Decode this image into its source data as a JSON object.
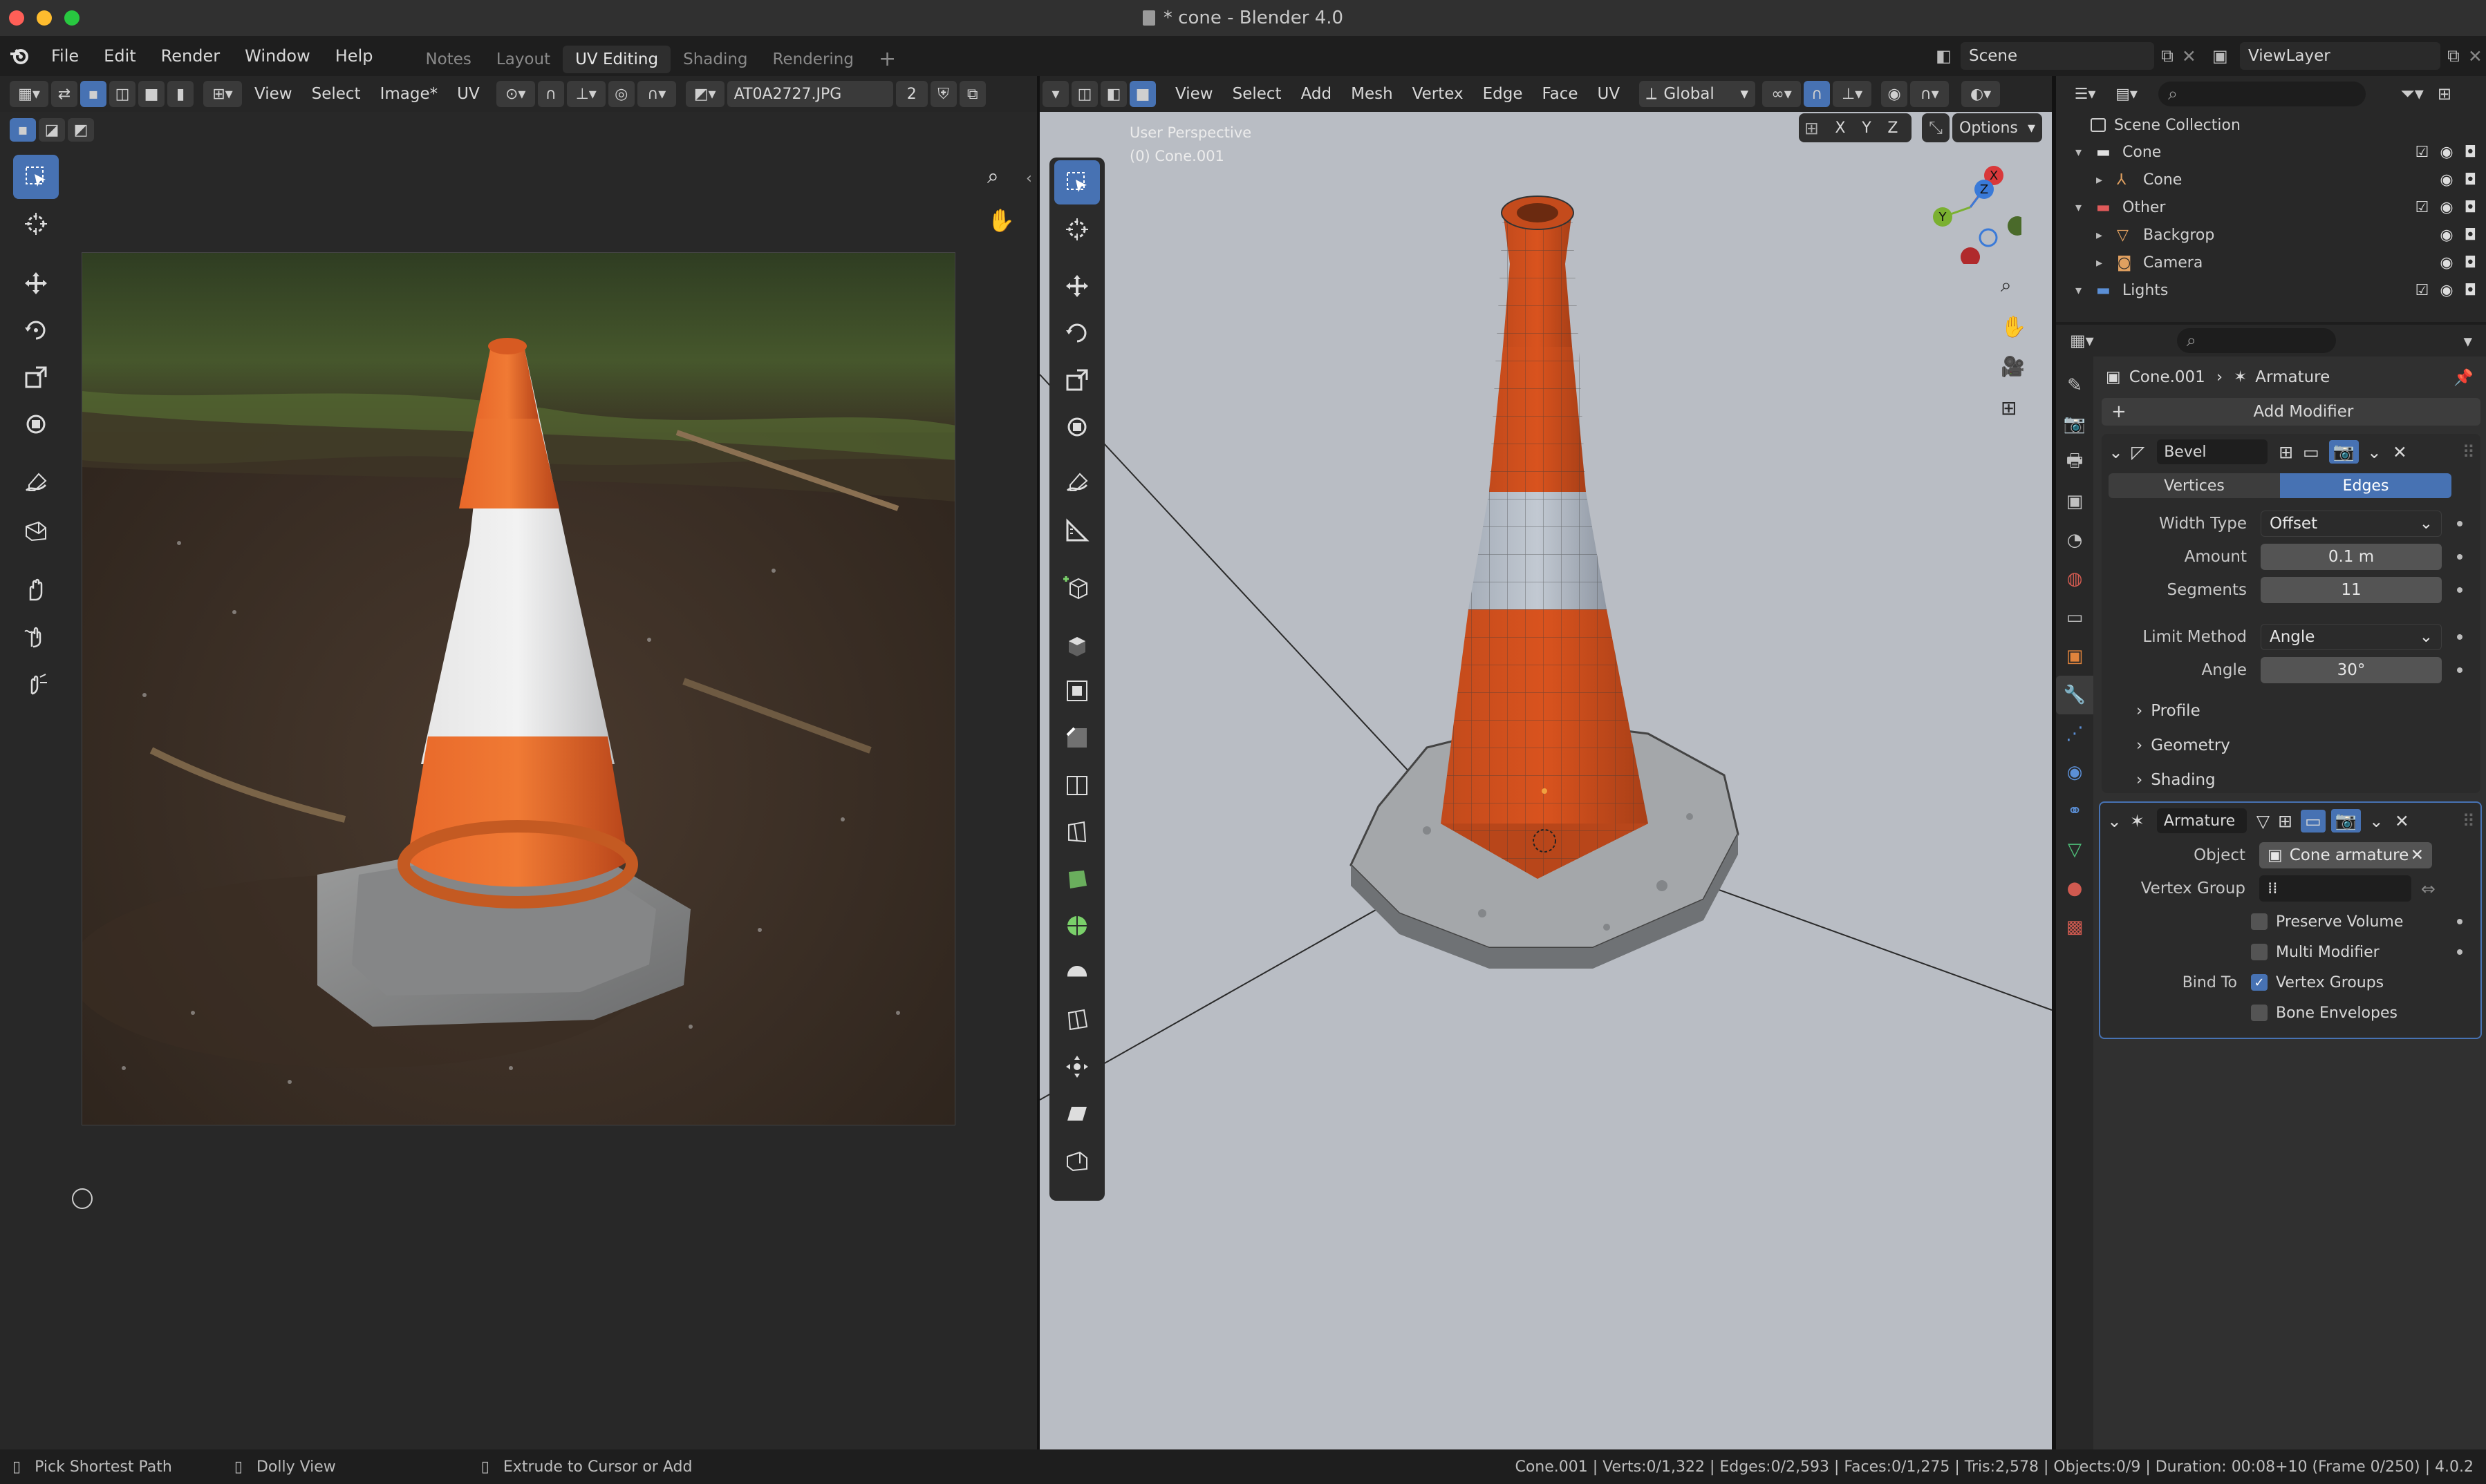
{
  "window": {
    "title": "* cone - Blender 4.0"
  },
  "menu": {
    "items": [
      "File",
      "Edit",
      "Render",
      "Window",
      "Help"
    ]
  },
  "workspaces": {
    "tabs": [
      "Notes",
      "Layout",
      "UV Editing",
      "Shading",
      "Rendering"
    ],
    "add": "+",
    "active": "UV Editing"
  },
  "scene": {
    "label": "Scene",
    "view_layer": "ViewLayer"
  },
  "uv_editor": {
    "menus": [
      "View",
      "Select",
      "Image*",
      "UV"
    ],
    "image_name": "AT0A2727.JPG",
    "user_count": "2"
  },
  "viewport": {
    "menus": [
      "View",
      "Select",
      "Add",
      "Mesh",
      "Vertex",
      "Edge",
      "Face",
      "UV"
    ],
    "orientation": "Global",
    "axes": [
      "X",
      "Y",
      "Z"
    ],
    "options": "Options",
    "overlay_title": "User Perspective",
    "overlay_object": "(0) Cone.001",
    "gizmo_labels": {
      "x": "X",
      "y": "Y",
      "z": "Z"
    }
  },
  "outliner": {
    "root": "Scene Collection",
    "rows": [
      {
        "name": "Cone",
        "indent": 1,
        "type": "collection"
      },
      {
        "name": "Cone",
        "indent": 2,
        "type": "armature"
      },
      {
        "name": "Other",
        "indent": 1,
        "type": "collection-red"
      },
      {
        "name": "Backgrop",
        "indent": 2,
        "type": "mesh"
      },
      {
        "name": "Camera",
        "indent": 2,
        "type": "camera"
      },
      {
        "name": "Lights",
        "indent": 1,
        "type": "collection-blue"
      }
    ]
  },
  "properties": {
    "breadcrumb": {
      "object": "Cone.001",
      "modifier": "Armature"
    },
    "add_modifier": "Add Modifier",
    "bevel": {
      "name": "Bevel",
      "mode_tabs": [
        "Vertices",
        "Edges"
      ],
      "active_tab": "Edges",
      "fields": [
        {
          "label": "Width Type",
          "value": "Offset",
          "type": "dropdown"
        },
        {
          "label": "Amount",
          "value": "0.1 m",
          "type": "number"
        },
        {
          "label": "Segments",
          "value": "11",
          "type": "number"
        },
        {
          "label": "Limit Method",
          "value": "Angle",
          "type": "dropdown"
        },
        {
          "label": "Angle",
          "value": "30°",
          "type": "number"
        }
      ],
      "subpanels": [
        "Profile",
        "Geometry",
        "Shading"
      ]
    },
    "armature": {
      "name": "Armature",
      "object_label": "Object",
      "object_value": "Cone armature",
      "vertex_group_label": "Vertex Group",
      "vertex_group_value": "",
      "options": [
        {
          "label": "Preserve Volume",
          "checked": false
        },
        {
          "label": "Multi Modifier",
          "checked": false
        }
      ],
      "bind_to_label": "Bind To",
      "bind_options": [
        {
          "label": "Vertex Groups",
          "checked": true
        },
        {
          "label": "Bone Envelopes",
          "checked": false
        }
      ]
    }
  },
  "status": {
    "left": [
      {
        "text": "Pick Shortest Path"
      },
      {
        "text": "Dolly View"
      },
      {
        "text": "Extrude to Cursor or Add"
      }
    ],
    "right": "Cone.001 | Verts:0/1,322 | Edges:0/2,593 | Faces:0/1,275 | Tris:2,578 | Objects:0/9 | Duration: 00:08+10 (Frame 0/250) | 4.0.2"
  },
  "colors": {
    "accent": "#4772b3",
    "cone_orange": "#d9531e",
    "viewport_bg": "#b9bdc4"
  }
}
